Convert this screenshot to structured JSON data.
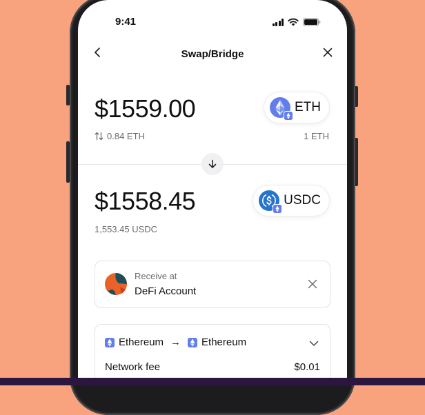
{
  "status_bar": {
    "time": "9:41"
  },
  "header": {
    "title": "Swap/Bridge"
  },
  "from": {
    "fiat_amount": "$1559.00",
    "sub_amount": "0.84 ETH",
    "token_symbol": "ETH",
    "rate": "1 ETH",
    "token_color": "#627EEA"
  },
  "to": {
    "fiat_amount": "$1558.45",
    "sub_amount": "1,553.45 USDC",
    "token_symbol": "USDC",
    "token_color": "#2775CA"
  },
  "receive": {
    "label": "Receive at",
    "account": "DeFi Account"
  },
  "route": {
    "from_network": "Ethereum",
    "arrow": "→",
    "to_network": "Ethereum",
    "fee_label": "Network fee",
    "fee_value": "$0.01"
  },
  "colors": {
    "background": "#F8A27E",
    "bottom_bar": "#2c1640",
    "eth": "#627EEA",
    "usdc": "#2775CA"
  }
}
